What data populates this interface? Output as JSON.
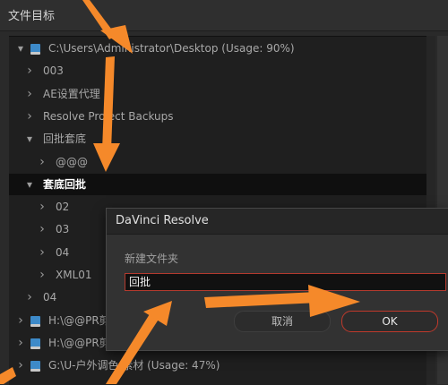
{
  "panel": {
    "title": "文件目标"
  },
  "tree": [
    {
      "label": "C:\\Users\\Administrator\\Desktop (Usage: 90%)",
      "expanded": true,
      "drive": true,
      "level": 0
    },
    {
      "label": "003",
      "expanded": false,
      "level": 1
    },
    {
      "label": "AE设置代理",
      "expanded": false,
      "level": 1
    },
    {
      "label": "Resolve Project Backups",
      "expanded": false,
      "level": 1
    },
    {
      "label": "回批套底",
      "expanded": true,
      "level": 1
    },
    {
      "label": "@@@",
      "expanded": false,
      "level": 2
    },
    {
      "label": "套底回批",
      "expanded": true,
      "level": 1,
      "selected": true
    },
    {
      "label": "02",
      "expanded": false,
      "level": 2
    },
    {
      "label": "03",
      "expanded": false,
      "level": 2
    },
    {
      "label": "04",
      "expanded": false,
      "level": 2
    },
    {
      "label": "XML01",
      "expanded": false,
      "level": 2
    },
    {
      "label": "04",
      "expanded": false,
      "level": 1
    },
    {
      "label": "H:\\@@PR剪",
      "expanded": false,
      "drive": true,
      "level": 0
    },
    {
      "label": "H:\\@@PR剪",
      "expanded": false,
      "drive": true,
      "level": 0
    },
    {
      "label": "G:\\U-户外调色  素材 (Usage: 47%)",
      "expanded": false,
      "drive": true,
      "level": 0
    }
  ],
  "dialog": {
    "title": "DaVinci Resolve",
    "label": "新建文件夹",
    "input_value": "回批",
    "cancel_label": "取消",
    "ok_label": "OK"
  },
  "colors": {
    "arrow": "#f5892a",
    "selected_row": "#0f0f0f",
    "ok_border": "#c0392b",
    "drive_icon": "#3d8ac9"
  }
}
